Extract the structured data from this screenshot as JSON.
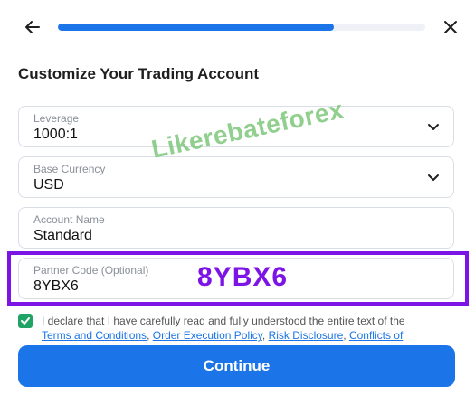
{
  "header": {
    "progress_percent": 75
  },
  "page_title": "Customize Your Trading Account",
  "fields": {
    "leverage": {
      "label": "Leverage",
      "value": "1000:1"
    },
    "base_currency": {
      "label": "Base Currency",
      "value": "USD"
    },
    "account_name": {
      "label": "Account Name",
      "value": "Standard"
    },
    "partner_code": {
      "label": "Partner Code (Optional)",
      "value": "8YBX6"
    }
  },
  "watermark": "Likerebateforex",
  "overlay_code": "8YBX6",
  "declaration": {
    "text": "I declare that I have carefully read and fully understood the entire text of the",
    "links": [
      "Terms and Conditions",
      "Order Execution Policy",
      "Risk Disclosure",
      "Conflicts of"
    ]
  },
  "continue_label": "Continue",
  "colors": {
    "primary": "#1b74e8",
    "highlight": "#7c14e6",
    "check": "#21a366",
    "watermark": "#7dc77a"
  }
}
